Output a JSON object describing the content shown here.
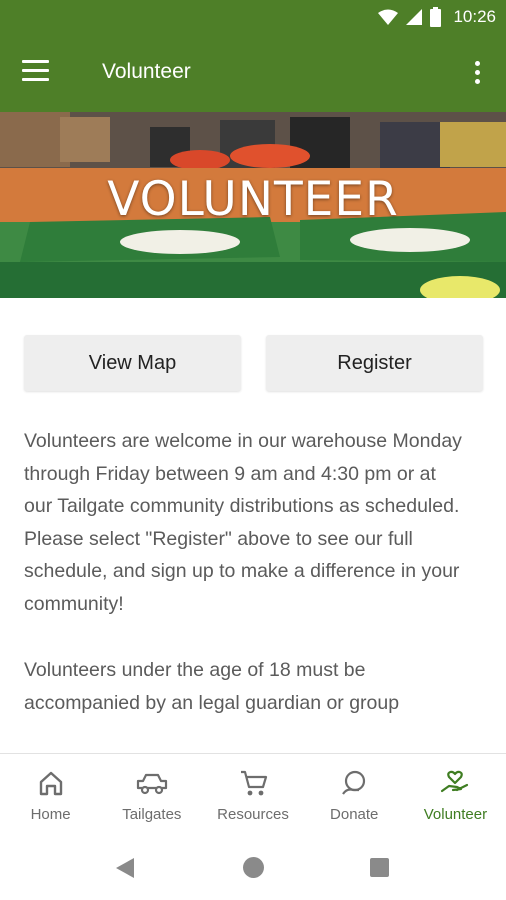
{
  "status_bar": {
    "time": "10:26"
  },
  "app_bar": {
    "title": "Volunteer"
  },
  "hero": {
    "title": "VOLUNTEER"
  },
  "buttons": {
    "view_map": "View Map",
    "register": "Register"
  },
  "content": {
    "paragraphs": [
      "Volunteers are welcome in our warehouse Monday through Friday between 9 am and 4:30 pm or at our Tailgate community distributions as scheduled. Please select \"Register\" above to see our full schedule, and sign up to make a difference in your community!",
      "Volunteers under the age of 18 must be accompanied by an legal guardian or group"
    ]
  },
  "bottom_nav": {
    "items": [
      {
        "label": "Home",
        "icon": "home-icon"
      },
      {
        "label": "Tailgates",
        "icon": "truck-icon"
      },
      {
        "label": "Resources",
        "icon": "cart-icon"
      },
      {
        "label": "Donate",
        "icon": "donate-icon"
      },
      {
        "label": "Volunteer",
        "icon": "volunteer-heart-icon",
        "active": true
      }
    ]
  },
  "colors": {
    "primary": "#4e7f28",
    "active_nav": "#3f7d22",
    "body_text": "#5b5b5b"
  }
}
